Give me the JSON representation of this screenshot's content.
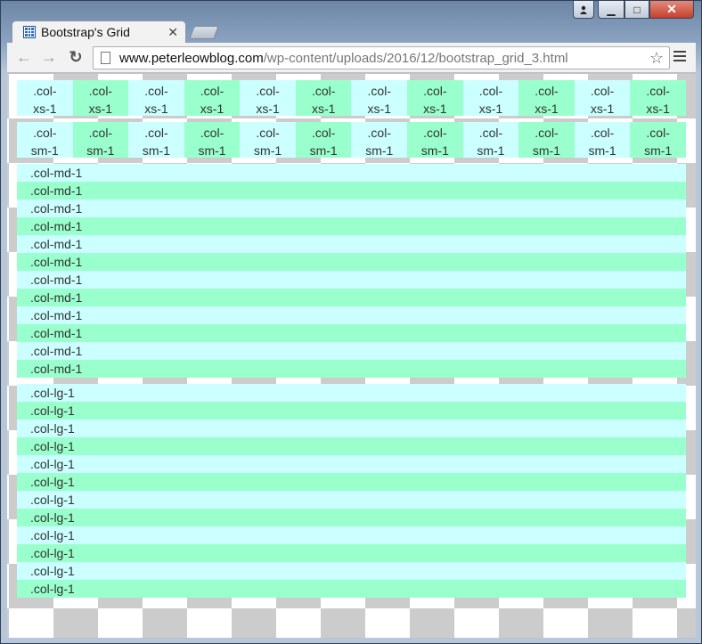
{
  "window": {
    "caption_close": "✕",
    "caption_max": "□",
    "caption_min": "▁"
  },
  "tab": {
    "title": "Bootstrap's Grid",
    "close": "✕"
  },
  "toolbar": {
    "back_icon": "←",
    "forward_icon": "→",
    "reload_icon": "↻",
    "url_host": "www.peterleowblog.com",
    "url_path": "/wp-content/uploads/2016/12/bootstrap_grid_3.html",
    "star_icon": "☆"
  },
  "grid": {
    "xs": [
      {
        "line1": ".col-",
        "line2": "xs-1"
      },
      {
        "line1": ".col-",
        "line2": "xs-1"
      },
      {
        "line1": ".col-",
        "line2": "xs-1"
      },
      {
        "line1": ".col-",
        "line2": "xs-1"
      },
      {
        "line1": ".col-",
        "line2": "xs-1"
      },
      {
        "line1": ".col-",
        "line2": "xs-1"
      },
      {
        "line1": ".col-",
        "line2": "xs-1"
      },
      {
        "line1": ".col-",
        "line2": "xs-1"
      },
      {
        "line1": ".col-",
        "line2": "xs-1"
      },
      {
        "line1": ".col-",
        "line2": "xs-1"
      },
      {
        "line1": ".col-",
        "line2": "xs-1"
      },
      {
        "line1": ".col-",
        "line2": "xs-1"
      }
    ],
    "sm": [
      {
        "line1": ".col-",
        "line2": "sm-1"
      },
      {
        "line1": ".col-",
        "line2": "sm-1"
      },
      {
        "line1": ".col-",
        "line2": "sm-1"
      },
      {
        "line1": ".col-",
        "line2": "sm-1"
      },
      {
        "line1": ".col-",
        "line2": "sm-1"
      },
      {
        "line1": ".col-",
        "line2": "sm-1"
      },
      {
        "line1": ".col-",
        "line2": "sm-1"
      },
      {
        "line1": ".col-",
        "line2": "sm-1"
      },
      {
        "line1": ".col-",
        "line2": "sm-1"
      },
      {
        "line1": ".col-",
        "line2": "sm-1"
      },
      {
        "line1": ".col-",
        "line2": "sm-1"
      },
      {
        "line1": ".col-",
        "line2": "sm-1"
      }
    ],
    "md": [
      ".col-md-1",
      ".col-md-1",
      ".col-md-1",
      ".col-md-1",
      ".col-md-1",
      ".col-md-1",
      ".col-md-1",
      ".col-md-1",
      ".col-md-1",
      ".col-md-1",
      ".col-md-1",
      ".col-md-1"
    ],
    "lg": [
      ".col-lg-1",
      ".col-lg-1",
      ".col-lg-1",
      ".col-lg-1",
      ".col-lg-1",
      ".col-lg-1",
      ".col-lg-1",
      ".col-lg-1",
      ".col-lg-1",
      ".col-lg-1",
      ".col-lg-1",
      ".col-lg-1"
    ],
    "colors": {
      "light": "#ccffff",
      "green": "#99ffcc"
    }
  }
}
